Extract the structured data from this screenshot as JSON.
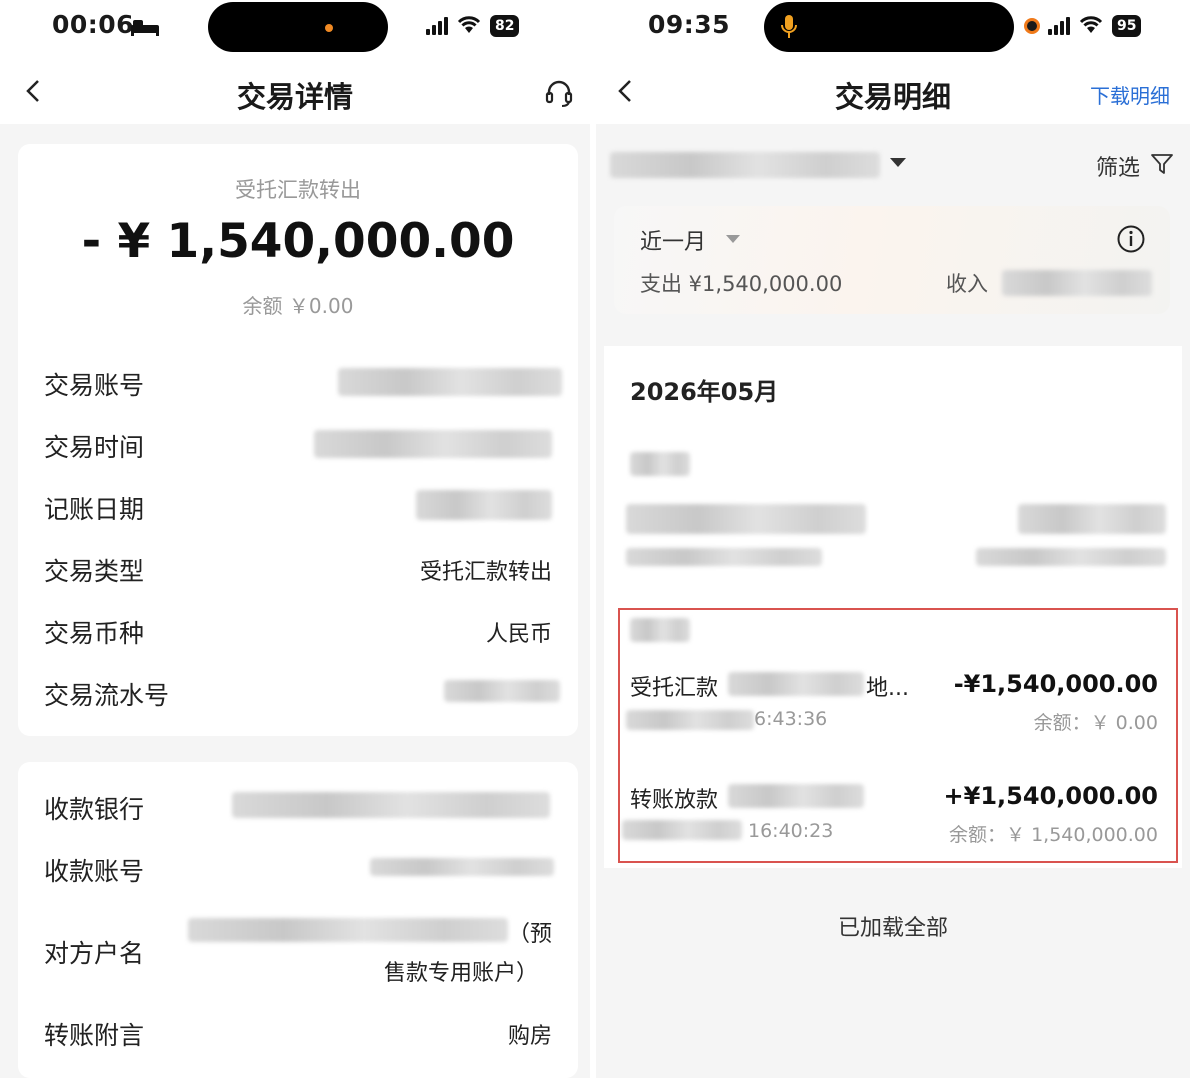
{
  "left": {
    "status": {
      "time": "00:06",
      "battery": "82"
    },
    "nav": {
      "title": "交易详情"
    },
    "summary": {
      "type": "受托汇款转出",
      "amount": "- ¥ 1,540,000.00",
      "balance": "余额 ￥0.00"
    },
    "details": [
      {
        "label": "交易账号",
        "value": ""
      },
      {
        "label": "交易时间",
        "value": ""
      },
      {
        "label": "记账日期",
        "value": ""
      },
      {
        "label": "交易类型",
        "value": "受托汇款转出"
      },
      {
        "label": "交易币种",
        "value": "人民币"
      },
      {
        "label": "交易流水号",
        "value": ""
      }
    ],
    "payee": {
      "bank_label": "收款银行",
      "account_label": "收款账号",
      "name_label": "对方户名",
      "name_suffix_1": "（预",
      "name_suffix_2": "售款专用账户）",
      "memo_label": "转账附言",
      "memo_value": "购房"
    }
  },
  "right": {
    "status": {
      "time": "09:35",
      "battery": "95"
    },
    "nav": {
      "title": "交易明细",
      "download": "下载明细"
    },
    "filter_label": "筛选",
    "summary": {
      "period": "近一月",
      "expense": "支出 ¥1,540,000.00",
      "income_label": "收入"
    },
    "month": "2026年05月",
    "transactions": [
      {
        "title": "受托汇款",
        "title_suffix": "地...",
        "amount": "-¥1,540,000.00",
        "time": "6:43:36",
        "balance": "余额：￥ 0.00"
      },
      {
        "title": "转账放款",
        "title_suffix": "",
        "amount": "+¥1,540,000.00",
        "time": "16:40:23",
        "balance": "余额：￥ 1,540,000.00"
      }
    ],
    "footer": "已加载全部"
  }
}
